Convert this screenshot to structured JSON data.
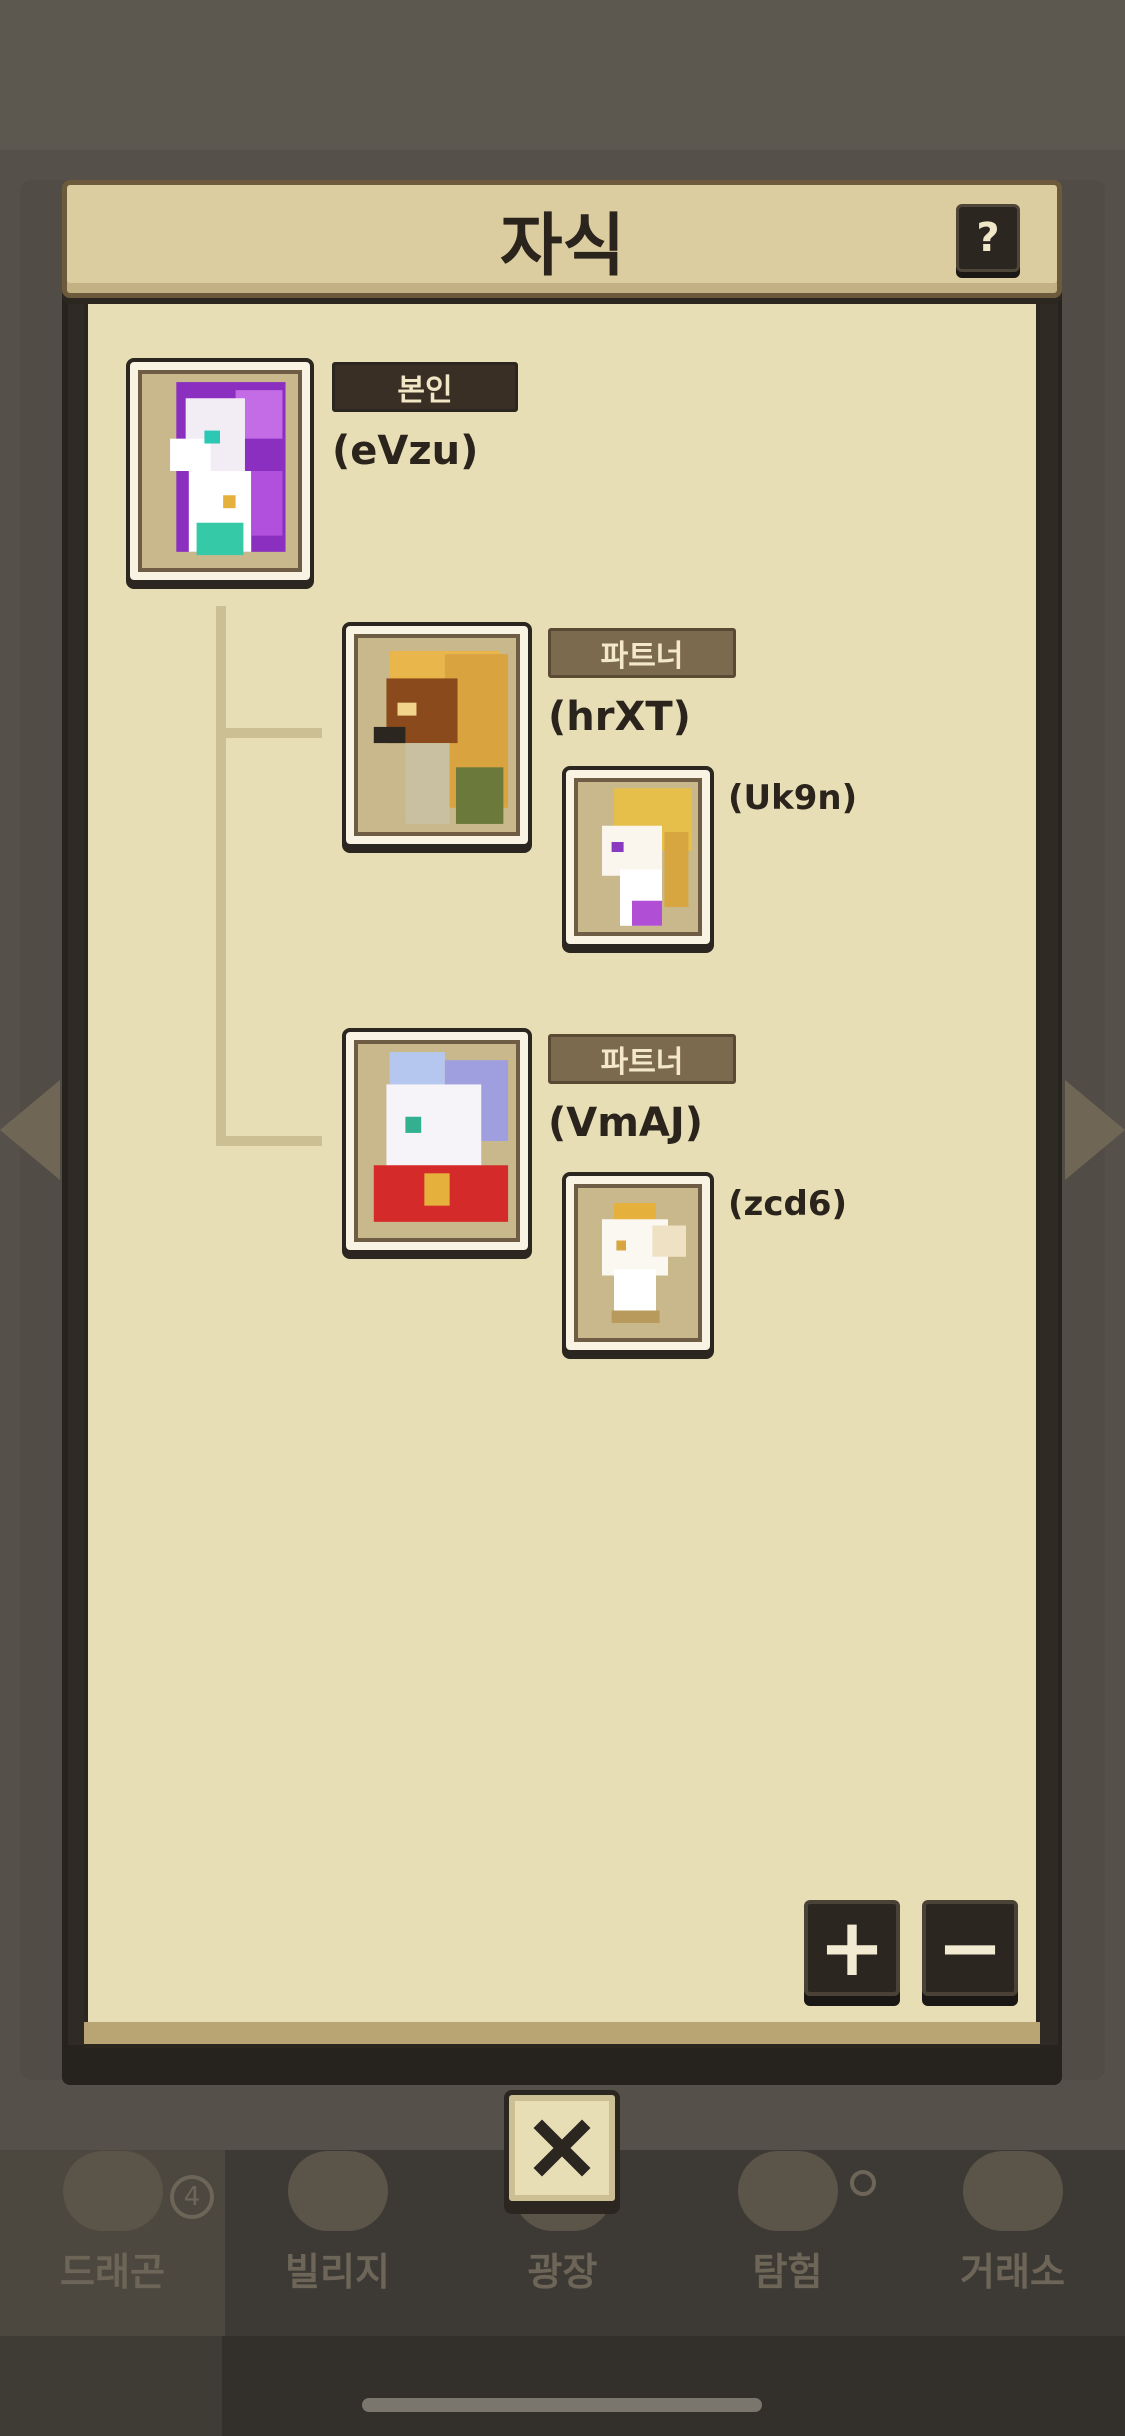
{
  "dialog": {
    "title": "자식",
    "help_label": "?"
  },
  "self": {
    "tag": "본인",
    "name": "(eVzu)"
  },
  "partners": [
    {
      "tag": "파트너",
      "name": "(hrXT)",
      "child": {
        "name": "(Uk9n)"
      }
    },
    {
      "tag": "파트너",
      "name": "(VmAJ)",
      "child": {
        "name": "(zcd6)"
      }
    }
  ],
  "zoom": {
    "in_label": "+",
    "out_label": "−"
  },
  "bottom_nav": {
    "items": [
      {
        "label": "드래곤",
        "badge": "4"
      },
      {
        "label": "빌리지"
      },
      {
        "label": "광장"
      },
      {
        "label": "탐험"
      },
      {
        "label": "거래소"
      }
    ]
  },
  "colors": {
    "panel": "#e8deb6",
    "frame": "#2b2620",
    "partner_tag": "#7c6a4e",
    "self_tag": "#3a2f24"
  }
}
